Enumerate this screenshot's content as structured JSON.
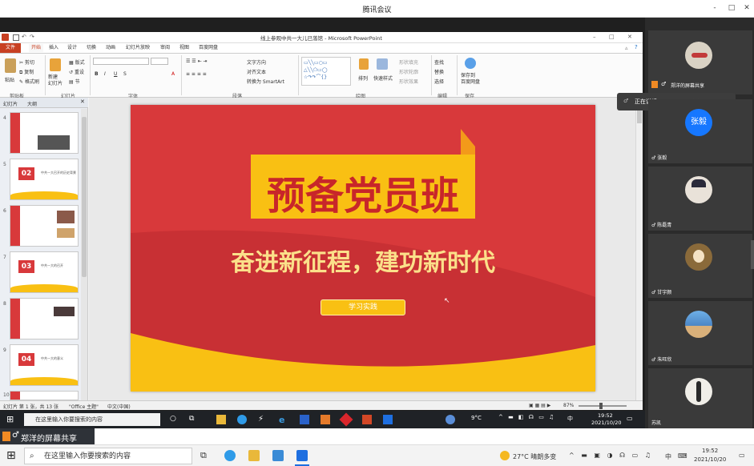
{
  "meeting": {
    "title": "腾讯会议",
    "win_min": "-",
    "win_max": "□",
    "win_close": "✕"
  },
  "ppt": {
    "window_title": "线上参观中共一大儿已落馆 - Microsoft PowerPoint",
    "tabs": [
      "文件",
      "开始",
      "插入",
      "设计",
      "切换",
      "动画",
      "幻灯片放映",
      "审阅",
      "视图",
      "百度网盘"
    ],
    "ribbon": {
      "paste": "粘贴",
      "cut": "剪切",
      "copy": "复制",
      "format_painter": "格式刷",
      "new_slide": "新建\n幻灯片",
      "layout": "版式",
      "reset": "重设",
      "section": "节",
      "text_direction": "文字方向",
      "align_text": "对齐文本",
      "smartart": "转换为 SmartArt",
      "arrange": "排列",
      "quick_styles": "快速样式",
      "shape_fill": "形状填充",
      "shape_outline": "形状轮廓",
      "shape_effects": "形状效果",
      "find": "查找",
      "replace": "替换",
      "select": "选择",
      "save_to": "保存到\n百度网盘",
      "groups": [
        "剪贴板",
        "幻灯片",
        "字体",
        "段落",
        "绘图",
        "编辑",
        "保存"
      ]
    },
    "pane_tabs": [
      "幻灯片",
      "大纲"
    ],
    "thumbs": [
      {
        "num": "4"
      },
      {
        "num": "5",
        "badge": "02",
        "text": "中共一大召开的历史背景"
      },
      {
        "num": "6"
      },
      {
        "num": "7",
        "badge": "03",
        "text": "中共一大的召开"
      },
      {
        "num": "8"
      },
      {
        "num": "9",
        "badge": "04",
        "text": "中共一大的意义"
      },
      {
        "num": "10"
      }
    ],
    "status": {
      "slide_info": "幻灯片 第 1 张，共 13 张",
      "theme": "\"Office 主题\"",
      "lang": "中文(中国)",
      "zoom": "87%"
    }
  },
  "slide": {
    "title": "预备党员班",
    "subtitle": "奋进新征程，建功新时代",
    "button": "学习实践"
  },
  "inner_taskbar": {
    "search": "在这里输入你要搜索的内容",
    "weather": "9°C",
    "ime": "中",
    "time": "19:52",
    "date": "2021/10/20"
  },
  "participants": [
    {
      "name": "郑洋的屏幕共享",
      "avatar_color": "#d9d2c4"
    },
    {
      "name": "张毅",
      "avatar_text": "张毅",
      "avatar_color": "#1677ff"
    },
    {
      "name": "陈磊青",
      "avatar_color": "#e9e2d9"
    },
    {
      "name": "甘宇颜",
      "avatar_color": "#8a6a3a"
    },
    {
      "name": "朱旺欣",
      "avatar_color": "#4b86c6"
    },
    {
      "name": "苏凯",
      "avatar_color": "#f0eee8"
    }
  ],
  "speaking": "正在讲话:",
  "share_banner": "郑洋的屏幕共享",
  "outer_taskbar": {
    "search": "在这里输入你要搜索的内容",
    "weather": "27°C 晴朗多变",
    "ime": "中",
    "time": "19:52",
    "date": "2021/10/20"
  },
  "colors": {
    "slide_red": "#d8393b",
    "slide_gold": "#f9c013",
    "ppt_file_tab": "#c84022"
  }
}
